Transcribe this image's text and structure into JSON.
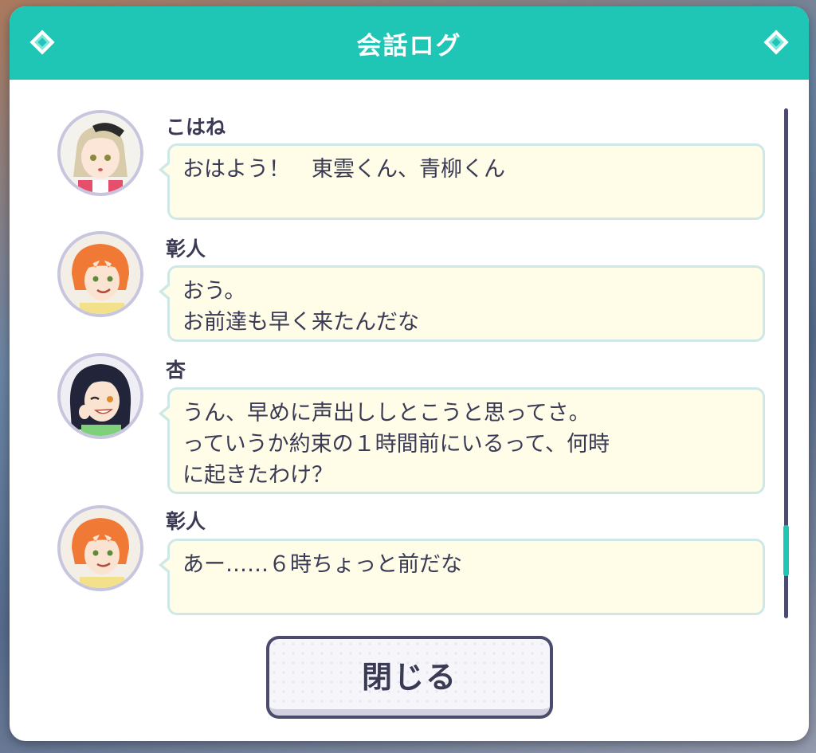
{
  "header": {
    "title": "会話ログ"
  },
  "entries": [
    {
      "speaker": "こはね",
      "lines": [
        "おはよう！　東雲くん、青柳くん"
      ]
    },
    {
      "speaker": "彰人",
      "lines": [
        "おう。",
        "お前達も早く来たんだな"
      ]
    },
    {
      "speaker": "杏",
      "lines": [
        "うん、早めに声出ししとこうと思ってさ。",
        "っていうか約束の１時間前にいるって、何時",
        "に起きたわけ？"
      ]
    },
    {
      "speaker": "彰人",
      "lines": [
        "あー……６時ちょっと前だな"
      ]
    }
  ],
  "close_button": {
    "label": "閉じる"
  },
  "colors": {
    "accent": "#1fc6b5",
    "bubble_bg": "#fffde8",
    "bubble_border": "#cde8e6",
    "text": "#3a3a55"
  }
}
